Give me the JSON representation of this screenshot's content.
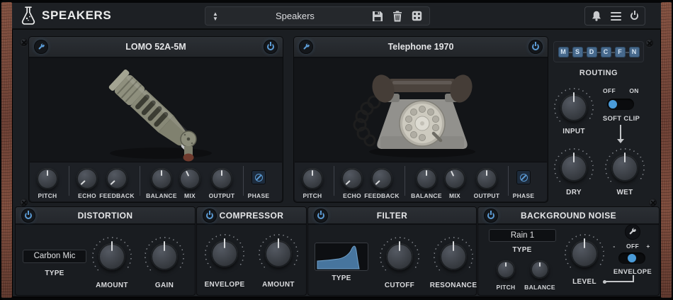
{
  "app": {
    "name": "SPEAKERS"
  },
  "topbar": {
    "preset": {
      "value": "Speakers"
    },
    "icons": [
      "flask-logo",
      "preset-spinner-up",
      "preset-spinner-down",
      "save",
      "trash",
      "randomize-dice",
      "bell",
      "menu",
      "power"
    ]
  },
  "modules": [
    {
      "title": "LOMO 52A-5M",
      "knobs": [
        "PITCH",
        "ECHO",
        "FEEDBACK",
        "BALANCE",
        "MIX",
        "OUTPUT"
      ],
      "phase_label": "PHASE"
    },
    {
      "title": "Telephone 1970",
      "knobs": [
        "PITCH",
        "ECHO",
        "FEEDBACK",
        "BALANCE",
        "MIX",
        "OUTPUT"
      ],
      "phase_label": "PHASE"
    }
  ],
  "routing": {
    "label": "ROUTING",
    "nodes": [
      "M",
      "S",
      "D",
      "C",
      "F",
      "N"
    ]
  },
  "io": {
    "input_label": "INPUT",
    "soft_clip": {
      "off": "OFF",
      "on": "ON",
      "label": "SOFT CLIP",
      "state": "off"
    },
    "dry_label": "DRY",
    "wet_label": "WET"
  },
  "sections": {
    "distortion": {
      "title": "DISTORTION",
      "type_value": "Carbon Mic",
      "type_label": "TYPE",
      "amount_label": "AMOUNT",
      "gain_label": "GAIN"
    },
    "compressor": {
      "title": "COMPRESSOR",
      "envelope_label": "ENVELOPE",
      "amount_label": "AMOUNT"
    },
    "filter": {
      "title": "FILTER",
      "type_label": "TYPE",
      "cutoff_label": "CUTOFF",
      "resonance_label": "RESONANCE"
    },
    "background_noise": {
      "title": "BACKGROUND NOISE",
      "type_value": "Rain 1",
      "type_label": "TYPE",
      "pitch_label": "PITCH",
      "balance_label": "BALANCE",
      "level_label": "LEVEL",
      "envelope": {
        "minus": "-",
        "state": "OFF",
        "plus": "+",
        "label": "ENVELOPE"
      }
    }
  },
  "colors": {
    "accent": "#5b9bd5",
    "toggle_knob": "#4a9bd8",
    "wood": "#75443a",
    "filter_fill": "#47759e"
  }
}
